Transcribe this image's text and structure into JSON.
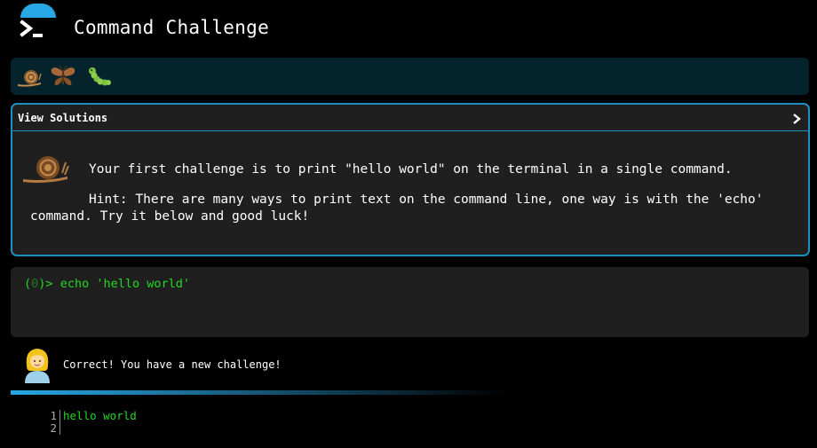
{
  "app": {
    "title": "Command Challenge",
    "accent_color": "#27a7e3",
    "logo_icon": "terminal-prompt-icon"
  },
  "levels": {
    "items": [
      {
        "icon": "snail-icon"
      },
      {
        "icon": "butterfly-icon"
      },
      {
        "icon": "caterpillar-icon"
      }
    ]
  },
  "challenge": {
    "header_label": "View Solutions",
    "expand_icon": "chevron-right-icon",
    "difficulty_icon": "snail-icon",
    "text": "Your first challenge is to print \"hello world\" on the terminal in a single command.",
    "hint": "Hint: There are many ways to print text on the command line, one way is with the 'echo' command. Try it below and good luck!"
  },
  "terminal": {
    "prompt_open": "(",
    "prompt_num": "0",
    "prompt_close": ")>",
    "command": "echo 'hello world'"
  },
  "feedback": {
    "avatar_icon": "woman-avatar-icon",
    "message": "Correct! You have a new challenge!",
    "progress": 0.6
  },
  "output": {
    "line_numbers": "1\n2",
    "text": "hello world"
  }
}
